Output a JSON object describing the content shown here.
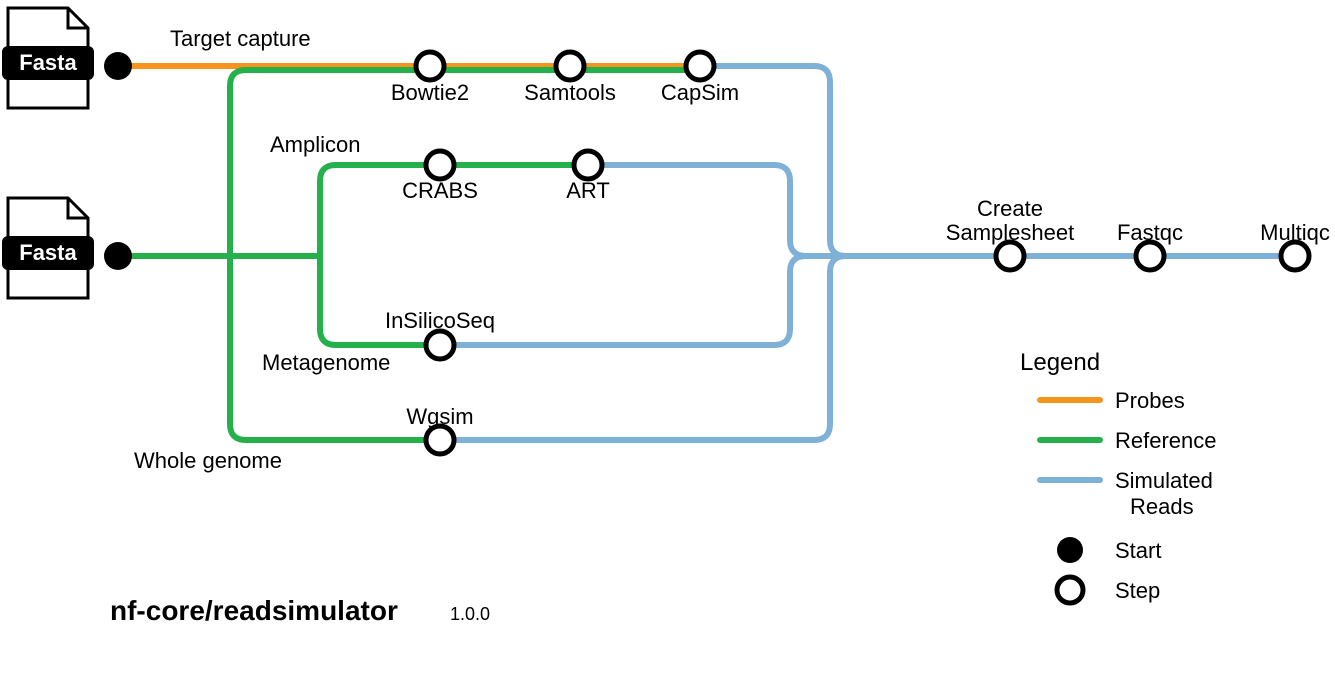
{
  "title": "nf-core/readsimulator",
  "version": "1.0.0",
  "inputs": {
    "probes_label": "Fasta",
    "reference_label": "Fasta"
  },
  "branches": {
    "target_capture": {
      "label": "Target capture",
      "steps": {
        "bowtie2": "Bowtie2",
        "samtools": "Samtools",
        "capsim": "CapSim"
      }
    },
    "amplicon": {
      "label": "Amplicon",
      "steps": {
        "crabs": "CRABS",
        "art": "ART"
      }
    },
    "metagenome": {
      "label": "Metagenome",
      "steps": {
        "insilicoseq": "InSilicoSeq"
      }
    },
    "whole_genome": {
      "label": "Whole genome",
      "steps": {
        "wgsim": "Wgsim"
      }
    }
  },
  "post_steps": {
    "create_samplesheet": {
      "l1": "Create",
      "l2": "Samplesheet"
    },
    "fastqc": "Fastqc",
    "multiqc": "Multiqc"
  },
  "legend": {
    "title": "Legend",
    "probes": "Probes",
    "reference": "Reference",
    "simulated_reads": {
      "l1": "Simulated",
      "l2": "Reads"
    },
    "start": "Start",
    "step": "Step"
  },
  "colors": {
    "probes": "#f7941d",
    "reference": "#24b04b",
    "simulated": "#7fb1d6",
    "node_fill": "#ffffff",
    "node_stroke": "#000000",
    "start_fill": "#000000"
  }
}
